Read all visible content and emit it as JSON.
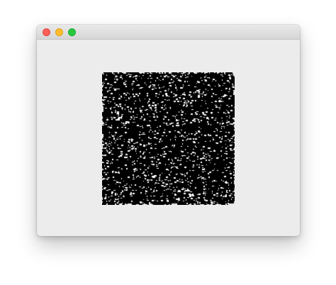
{
  "window": {
    "title": "",
    "controls": {
      "close": {
        "icon": "close-dot-icon",
        "color": "#fe5f57"
      },
      "minimize": {
        "icon": "minimize-dot-icon",
        "color": "#febc2e"
      },
      "maximize": {
        "icon": "maximize-dot-icon",
        "color": "#28c840"
      }
    },
    "background": "#ececec"
  },
  "content": {
    "image": {
      "kind": "random-noise",
      "foreground": "#000000",
      "background": "#ffffff",
      "white_fraction": 0.12
    }
  }
}
